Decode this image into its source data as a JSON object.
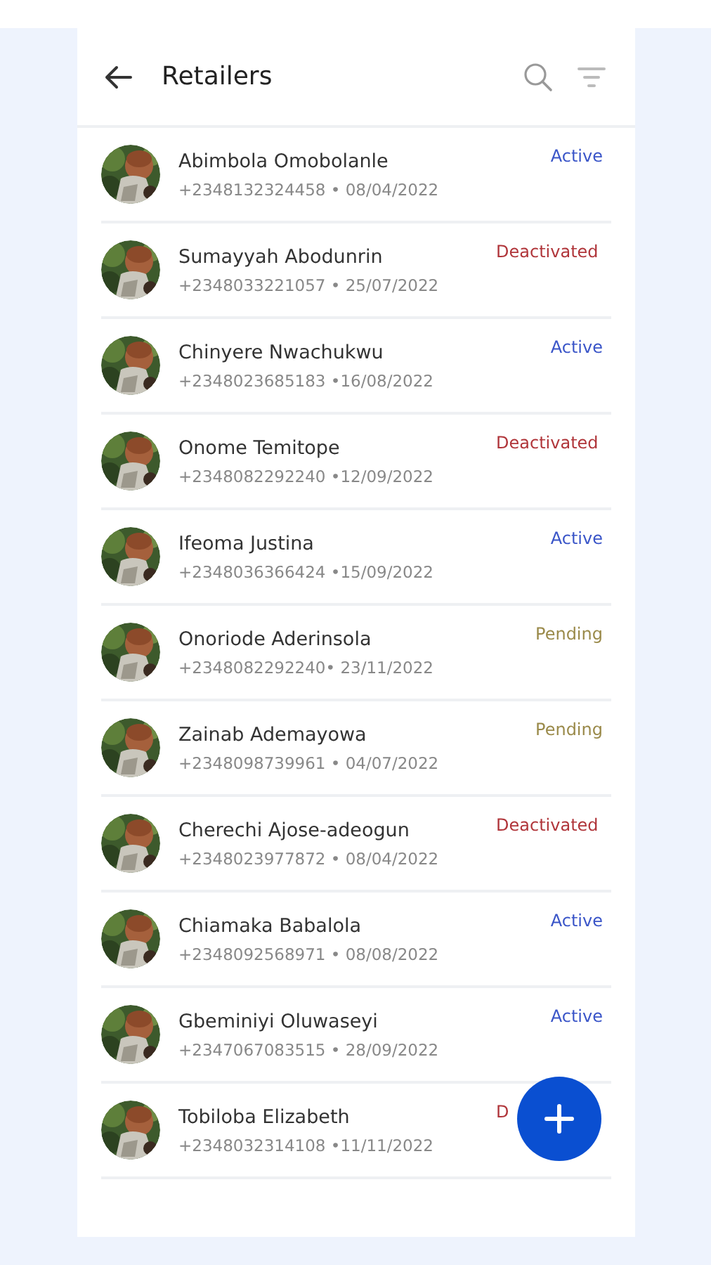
{
  "header": {
    "title": "Retailers"
  },
  "retailers": [
    {
      "name": "Abimbola Omobolanle",
      "details": "+2348132324458 • 08/04/2022",
      "status": "Active",
      "kind": "active"
    },
    {
      "name": "Sumayyah Abodunrin",
      "details": "+2348033221057 • 25/07/2022",
      "status": "Deactivated",
      "kind": "deactivated"
    },
    {
      "name": "Chinyere Nwachukwu",
      "details": "+2348023685183 •16/08/2022",
      "status": "Active",
      "kind": "active"
    },
    {
      "name": "Onome Temitope",
      "details": "+2348082292240 •12/09/2022",
      "status": "Deactivated",
      "kind": "deactivated"
    },
    {
      "name": "Ifeoma Justina",
      "details": "+2348036366424 •15/09/2022",
      "status": "Active",
      "kind": "active"
    },
    {
      "name": "Onoriode Aderinsola",
      "details": "+2348082292240• 23/11/2022",
      "status": "Pending",
      "kind": "pending"
    },
    {
      "name": "Zainab Ademayowa",
      "details": "+2348098739961 • 04/07/2022",
      "status": "Pending",
      "kind": "pending"
    },
    {
      "name": "Cherechi Ajose-adeogun",
      "details": "+2348023977872 • 08/04/2022",
      "status": "Deactivated",
      "kind": "deactivated"
    },
    {
      "name": "Chiamaka Babalola",
      "details": "+2348092568971 • 08/08/2022",
      "status": "Active",
      "kind": "active"
    },
    {
      "name": "Gbeminiyi Oluwaseyi",
      "details": "+2347067083515 • 28/09/2022",
      "status": "Active",
      "kind": "active"
    },
    {
      "name": "Tobiloba Elizabeth",
      "details": "+2348032314108 •11/11/2022",
      "status": "D",
      "kind": "deactivated"
    }
  ]
}
